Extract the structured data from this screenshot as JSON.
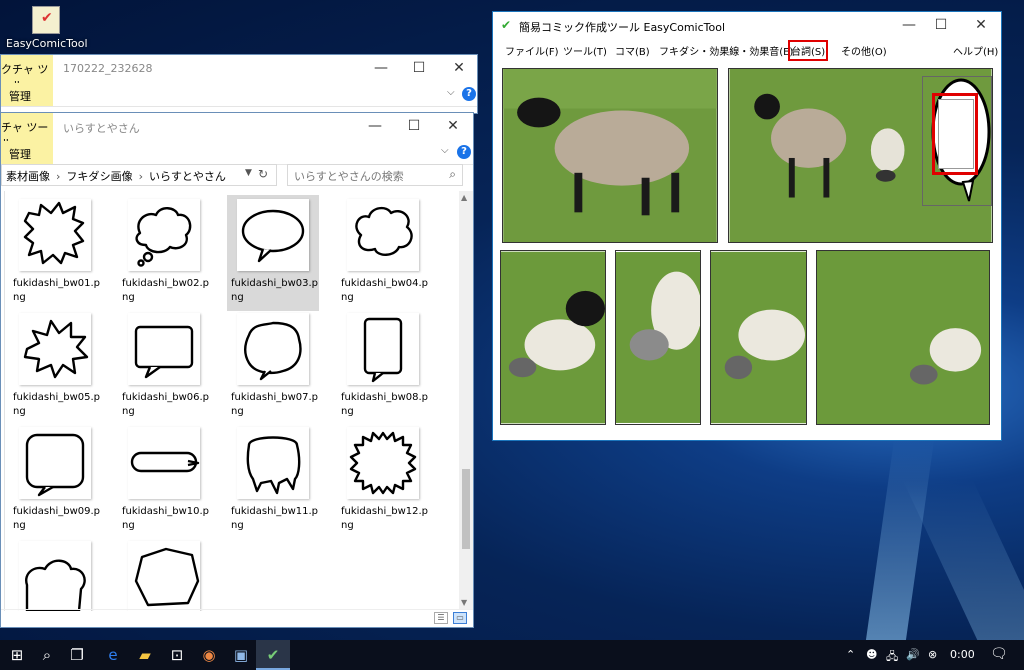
{
  "desktop": {
    "icon_label": "EasyComicTool",
    "icon_name": "easycomictool-app-icon"
  },
  "explorer_back": {
    "tool_tab": "クチャ ツール",
    "title": "170222_232628",
    "ribbon_tab": "管理"
  },
  "explorer": {
    "tool_tab": "チャ ツール",
    "title": "いらすとやさん",
    "ribbon_tab": "管理",
    "breadcrumb": [
      "素材画像",
      "フキダシ画像",
      "いらすとやさん"
    ],
    "search_placeholder": "いらすとやさんの検索",
    "files": [
      {
        "name": "fukidashi_bw01.png",
        "shape": "spiky"
      },
      {
        "name": "fukidashi_bw02.png",
        "shape": "thought"
      },
      {
        "name": "fukidashi_bw03.png",
        "shape": "oval",
        "selected": true
      },
      {
        "name": "fukidashi_bw04.png",
        "shape": "cloud"
      },
      {
        "name": "fukidashi_bw05.png",
        "shape": "star"
      },
      {
        "name": "fukidashi_bw06.png",
        "shape": "rect"
      },
      {
        "name": "fukidashi_bw07.png",
        "shape": "bumpy"
      },
      {
        "name": "fukidashi_bw08.png",
        "shape": "tall"
      },
      {
        "name": "fukidashi_bw09.png",
        "shape": "square"
      },
      {
        "name": "fukidashi_bw10.png",
        "shape": "flat"
      },
      {
        "name": "fukidashi_bw11.png",
        "shape": "drip"
      },
      {
        "name": "fukidashi_bw12.png",
        "shape": "flower"
      },
      {
        "name": "",
        "shape": "cloud2"
      },
      {
        "name": "",
        "shape": "hex"
      }
    ]
  },
  "ect": {
    "title": "簡易コミック作成ツール EasyComicTool",
    "menu": [
      {
        "label": "ファイル(F)"
      },
      {
        "label": "ツール(T)"
      },
      {
        "label": "コマ(B)"
      },
      {
        "label": "フキダシ・効果線・効果音(E)"
      },
      {
        "label": "台詞(S)",
        "highlighted": true
      },
      {
        "label": "その他(O)"
      },
      {
        "label": "ヘルプ(H)"
      }
    ]
  },
  "taskbar": {
    "clock": "0:00",
    "icons": [
      "windows-start-icon",
      "search-icon",
      "task-view-icon",
      "edge-browser-icon",
      "file-explorer-icon",
      "store-icon",
      "chrome-icon",
      "photos-icon",
      "easycomictool-icon"
    ]
  },
  "colors": {
    "highlight_red": "#e00000",
    "tool_tab_yellow": "#fbf2a3",
    "grass": "#6a9a3a"
  }
}
